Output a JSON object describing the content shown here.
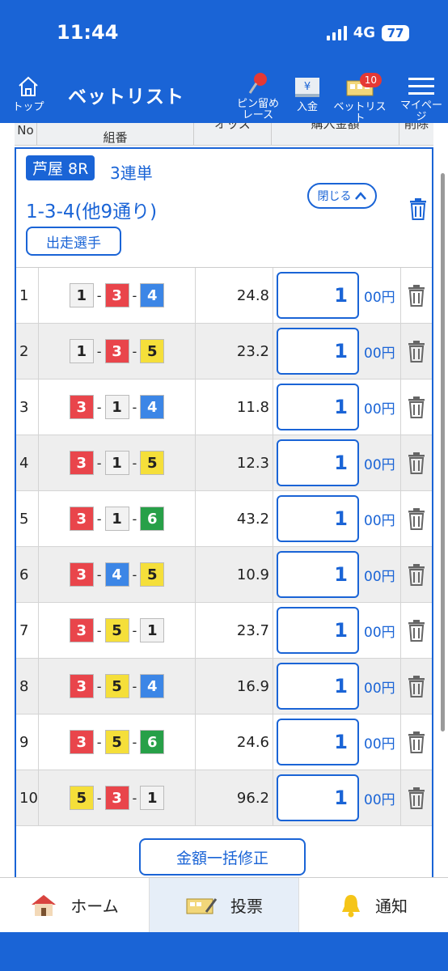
{
  "status": {
    "time": "11:44",
    "network": "4G",
    "battery": "77"
  },
  "header": {
    "home_label": "トップ",
    "title": "ベットリスト",
    "pin_label_1": "ピン留め",
    "pin_label_2": "レース",
    "deposit_label": "入金",
    "betlist_label": "ベットリスト",
    "betlist_badge": "10",
    "mypage_label": "マイページ"
  },
  "columns": {
    "no": "No",
    "combo": "組番",
    "odds": "オッズ",
    "amount": "購入金額",
    "delete": "削除"
  },
  "race": {
    "venue_race": "芦屋 8R",
    "bet_type": "3連単",
    "combo_summary": "1-3-4(他9通り)",
    "close_label": "閉じる",
    "entrants_label": "出走選手"
  },
  "boat_colors": {
    "1": "#f2f2f2",
    "2": "#222222",
    "3": "#e9454b",
    "4": "#3c86e6",
    "5": "#f5df3a",
    "6": "#27a048"
  },
  "boat_text_colors": {
    "1": "#222222",
    "2": "#ffffff",
    "3": "#ffffff",
    "4": "#ffffff",
    "5": "#222222",
    "6": "#ffffff"
  },
  "bets": [
    {
      "no": "1",
      "combo": [
        "1",
        "3",
        "4"
      ],
      "odds": "24.8",
      "amount": "1",
      "unit": "00円"
    },
    {
      "no": "2",
      "combo": [
        "1",
        "3",
        "5"
      ],
      "odds": "23.2",
      "amount": "1",
      "unit": "00円"
    },
    {
      "no": "3",
      "combo": [
        "3",
        "1",
        "4"
      ],
      "odds": "11.8",
      "amount": "1",
      "unit": "00円"
    },
    {
      "no": "4",
      "combo": [
        "3",
        "1",
        "5"
      ],
      "odds": "12.3",
      "amount": "1",
      "unit": "00円"
    },
    {
      "no": "5",
      "combo": [
        "3",
        "1",
        "6"
      ],
      "odds": "43.2",
      "amount": "1",
      "unit": "00円"
    },
    {
      "no": "6",
      "combo": [
        "3",
        "4",
        "5"
      ],
      "odds": "10.9",
      "amount": "1",
      "unit": "00円"
    },
    {
      "no": "7",
      "combo": [
        "3",
        "5",
        "1"
      ],
      "odds": "23.7",
      "amount": "1",
      "unit": "00円"
    },
    {
      "no": "8",
      "combo": [
        "3",
        "5",
        "4"
      ],
      "odds": "16.9",
      "amount": "1",
      "unit": "00円"
    },
    {
      "no": "9",
      "combo": [
        "3",
        "5",
        "6"
      ],
      "odds": "24.6",
      "amount": "1",
      "unit": "00円"
    },
    {
      "no": "10",
      "combo": [
        "5",
        "3",
        "1"
      ],
      "odds": "96.2",
      "amount": "1",
      "unit": "00円"
    }
  ],
  "bulk_edit_label": "金額一括修正",
  "bottom_nav": {
    "home": "ホーム",
    "vote": "投票",
    "notify": "通知"
  },
  "accent_color": "#1a64d6"
}
